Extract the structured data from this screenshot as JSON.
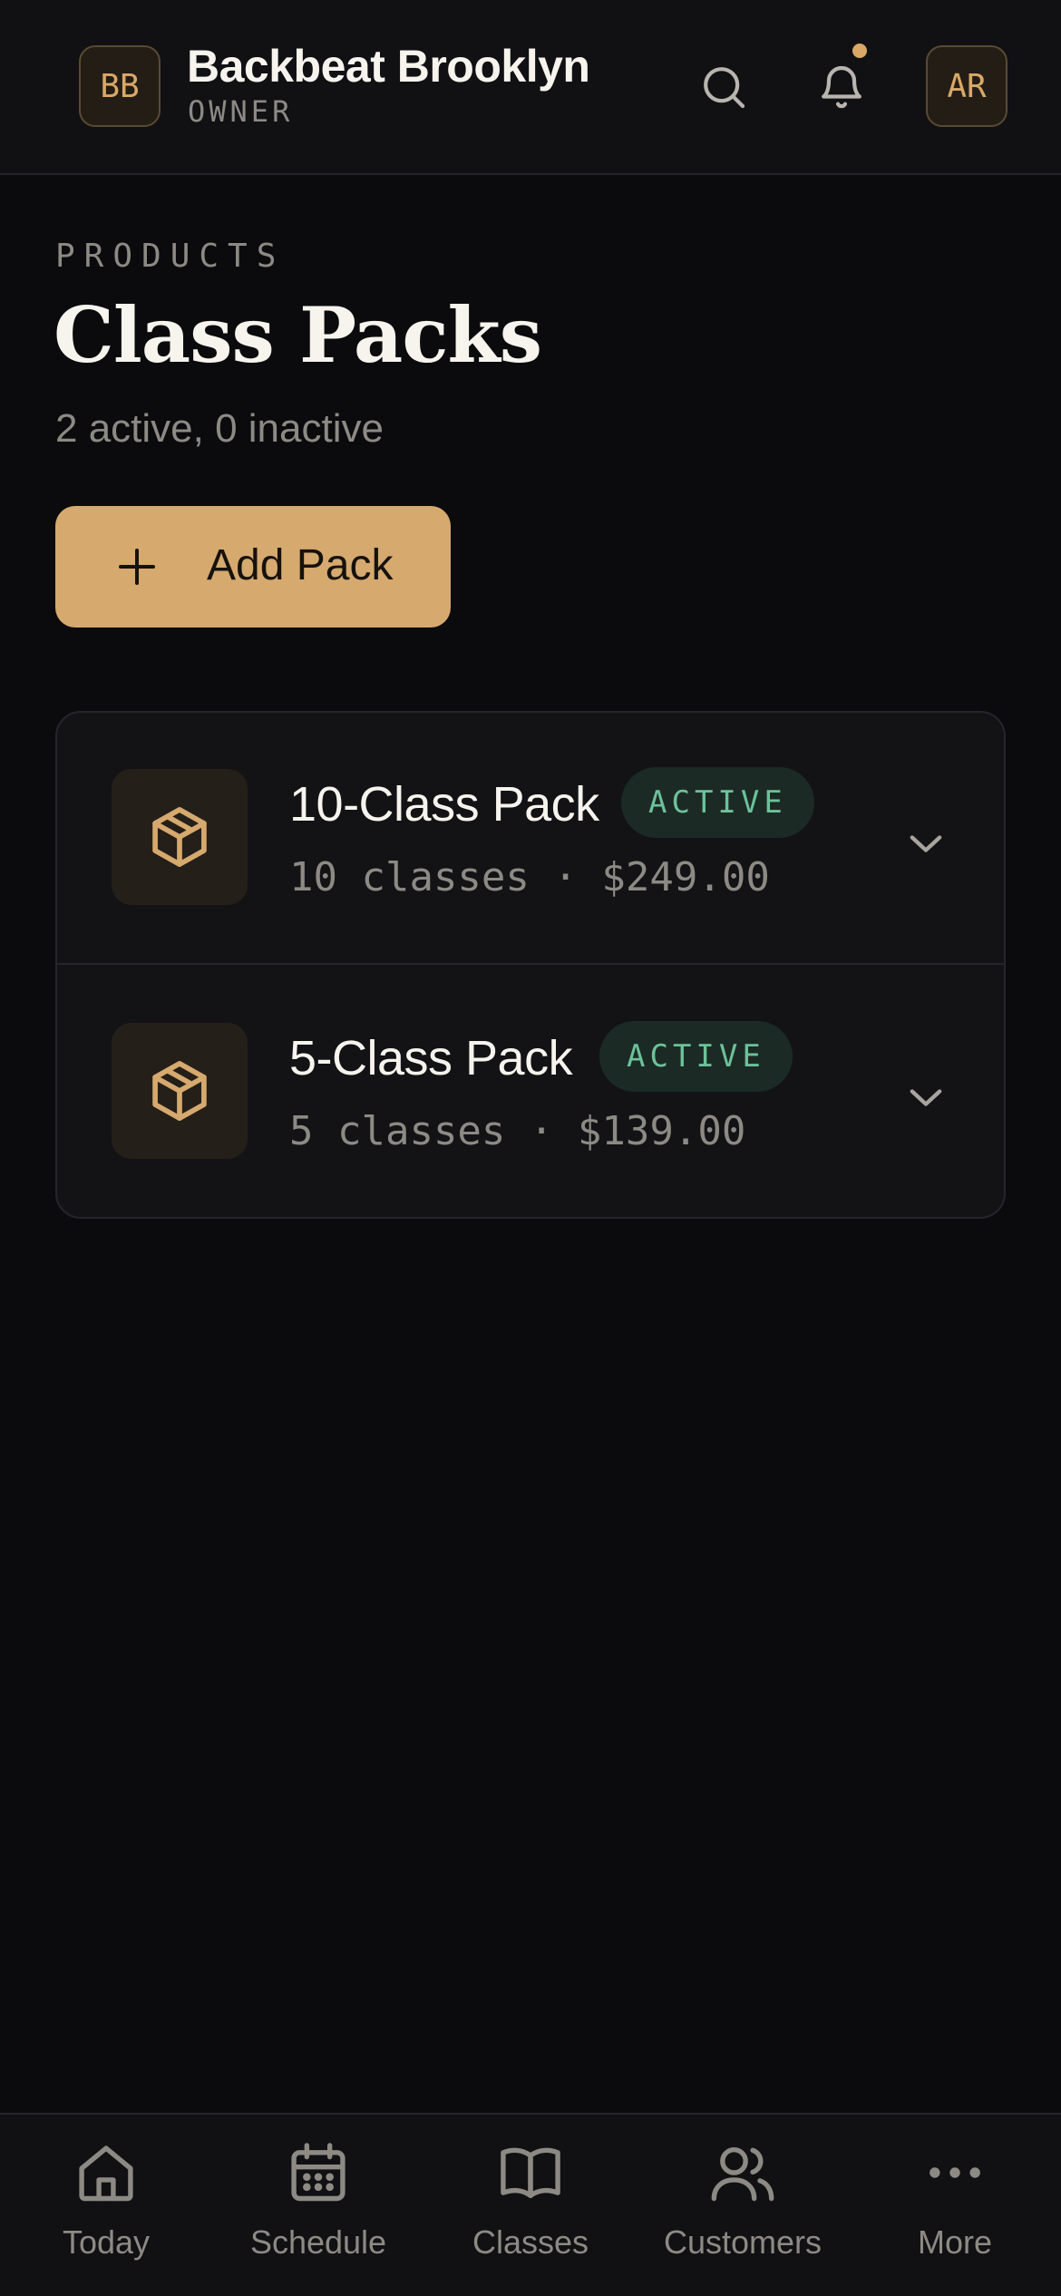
{
  "header": {
    "org_initials": "BB",
    "org_name": "Backbeat Brooklyn",
    "role": "OWNER",
    "user_initials": "AR",
    "has_notification": true
  },
  "main": {
    "eyebrow": "PRODUCTS",
    "title": "Class Packs",
    "subtitle": "2 active, 0 inactive",
    "add_button_label": "Add Pack"
  },
  "packs": [
    {
      "name": "10-Class Pack",
      "status": "ACTIVE",
      "meta": "10 classes · $249.00",
      "icon": "package-icon"
    },
    {
      "name": "5-Class Pack",
      "status": "ACTIVE",
      "meta": "5 classes · $139.00",
      "icon": "package-icon"
    }
  ],
  "nav": [
    {
      "label": "Today",
      "icon": "home-icon"
    },
    {
      "label": "Schedule",
      "icon": "calendar-icon"
    },
    {
      "label": "Classes",
      "icon": "book-icon"
    },
    {
      "label": "Customers",
      "icon": "users-icon"
    },
    {
      "label": "More",
      "icon": "more-icon"
    }
  ],
  "colors": {
    "background": "#0b0b0d",
    "accent": "#d6a96e",
    "active_text": "#6cc29a",
    "muted_text": "#8d8a84"
  }
}
